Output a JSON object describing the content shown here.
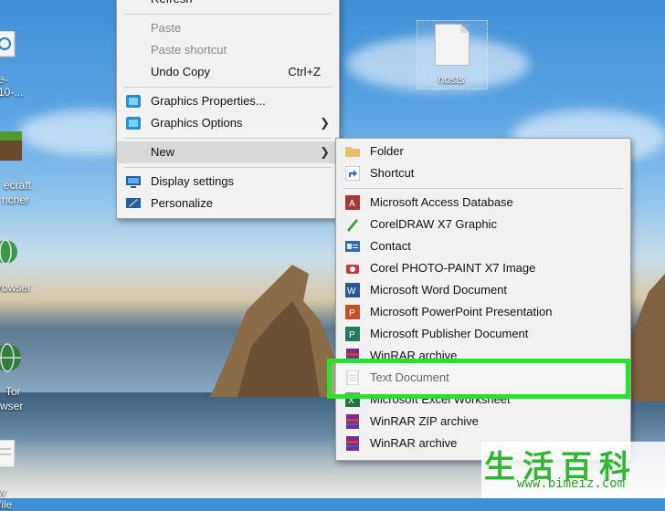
{
  "desktop": {
    "icons": [
      {
        "label": "e-10-..."
      },
      {
        "label": "ecraft"
      },
      {
        "label": "ncher"
      },
      {
        "label": "rowser"
      },
      {
        "label": "Tor"
      },
      {
        "label": "wser"
      },
      {
        "label": "w file"
      }
    ],
    "hosts_icon": {
      "label": "hosts"
    }
  },
  "context_menu": {
    "items": [
      {
        "label": "Refresh"
      },
      {
        "label": "Paste"
      },
      {
        "label": "Paste shortcut"
      },
      {
        "label": "Undo Copy",
        "shortcut": "Ctrl+Z"
      },
      {
        "label": "Graphics Properties..."
      },
      {
        "label": "Graphics Options"
      },
      {
        "label": "New"
      },
      {
        "label": "Display settings"
      },
      {
        "label": "Personalize"
      }
    ]
  },
  "new_submenu": {
    "items": [
      {
        "label": "Folder"
      },
      {
        "label": "Shortcut"
      },
      {
        "label": "Microsoft Access Database"
      },
      {
        "label": "CorelDRAW X7 Graphic"
      },
      {
        "label": "Contact"
      },
      {
        "label": "Corel PHOTO-PAINT X7 Image"
      },
      {
        "label": "Microsoft Word Document"
      },
      {
        "label": "Microsoft PowerPoint Presentation"
      },
      {
        "label": "Microsoft Publisher Document"
      },
      {
        "label": "WinRAR archive"
      },
      {
        "label": "Text Document"
      },
      {
        "label": "Microsoft Excel Worksheet"
      },
      {
        "label": "WinRAR ZIP archive"
      },
      {
        "label": "WinRAR archive"
      }
    ]
  },
  "watermark": {
    "chars": "生活百科",
    "url": "www.bimeiz.com"
  },
  "colors": {
    "highlight": "#27e22a",
    "menu_bg": "#f2f2f2"
  }
}
